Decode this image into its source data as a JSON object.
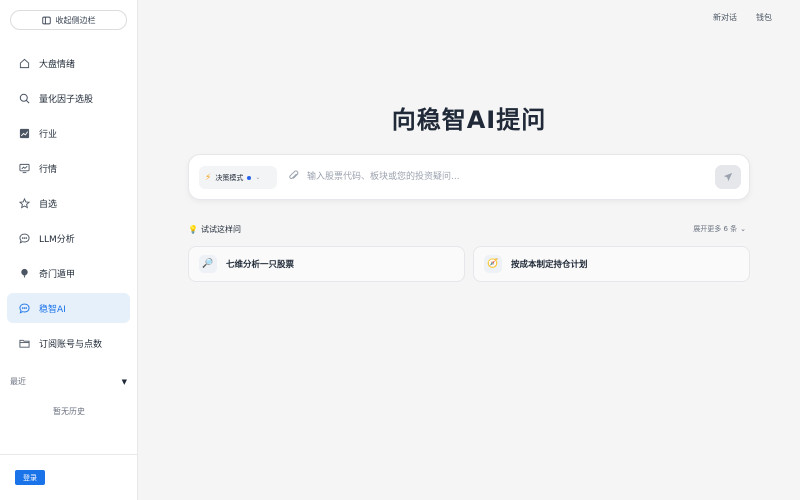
{
  "sidebar": {
    "collapse_label": "收起侧边栏",
    "items": [
      {
        "label": "大盘情绪",
        "icon": "home-icon",
        "active": false
      },
      {
        "label": "量化因子选股",
        "icon": "search-icon",
        "active": false
      },
      {
        "label": "行业",
        "icon": "chart-icon",
        "active": false
      },
      {
        "label": "行情",
        "icon": "monitor-icon",
        "active": false
      },
      {
        "label": "自选",
        "icon": "star-icon",
        "active": false
      },
      {
        "label": "LLM分析",
        "icon": "chat-bubble-icon",
        "active": false
      },
      {
        "label": "奇门遁甲",
        "icon": "gourd-icon",
        "active": false
      },
      {
        "label": "稳智AI",
        "icon": "chat-bubble-icon",
        "active": true
      },
      {
        "label": "订阅账号与点数",
        "icon": "folder-icon",
        "active": false
      }
    ],
    "recent_label": "最近",
    "no_history": "暂无历史",
    "login_label": "登录"
  },
  "topbar": {
    "new_chat": "新对话",
    "wallet": "钱包"
  },
  "main": {
    "title": "向稳智AI提问",
    "mode_label": "决策模式",
    "input_placeholder": "输入股票代码、板块或您的投资疑问...",
    "try_label": "试试这样问",
    "expand_more": "展开更多 6 条",
    "suggestions": [
      {
        "label": "七维分析一只股票",
        "icon": "magnifier-icon"
      },
      {
        "label": "按成本制定持仓计划",
        "icon": "compass-icon"
      }
    ]
  },
  "colors": {
    "accent": "#1a73e8",
    "active_bg": "#e6f0fb",
    "background": "#f5f5f5"
  }
}
